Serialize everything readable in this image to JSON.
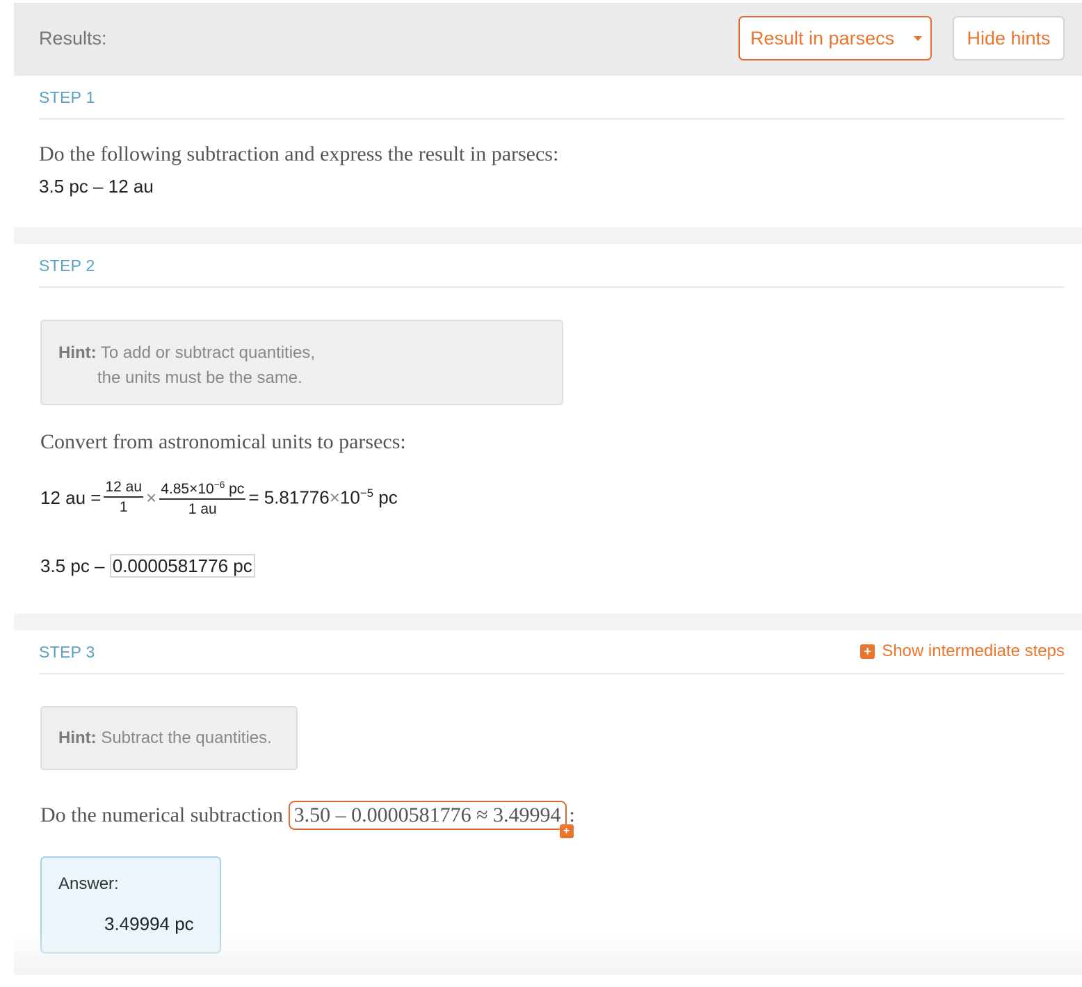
{
  "header": {
    "title": "Results:",
    "unit_select": {
      "selected": "Result in parsecs",
      "icon": "caret-down-icon"
    },
    "hints_button": "Hide hints"
  },
  "colors": {
    "accent": "#e8762f",
    "step_label": "#5c9fc5",
    "answer_bg": "#eaf6fc"
  },
  "steps": [
    {
      "label": "STEP 1",
      "instruction": "Do the following subtraction and express the result in parsecs:",
      "expression": "3.5 pc – 12 au"
    },
    {
      "label": "STEP 2",
      "hint": {
        "prefix": "Hint:",
        "line1": "To add or subtract quantities,",
        "line2": "the units must be the same."
      },
      "instruction": "Convert from astronomical units to parsecs:",
      "conversion": {
        "lhs": "12 au =",
        "frac1_num": "12 au",
        "frac1_den": "1",
        "times": "×",
        "frac2_num_mant": "4.85×10",
        "frac2_num_exp": "−6",
        "frac2_num_unit": " pc",
        "frac2_den": "1 au",
        "result_pre": "= 5.81776",
        "result_times": "×",
        "result_base": "10",
        "result_exp": "−5",
        "result_unit": " pc"
      },
      "restated_left": "3.5 pc –",
      "restated_boxed": "0.0000581776 pc"
    },
    {
      "label": "STEP 3",
      "show_steps": "Show intermediate steps",
      "hint": {
        "prefix": "Hint:",
        "text": "Subtract the quantities."
      },
      "instruction": "Do the numerical subtraction",
      "calculation": "3.50 – 0.0000581776 ≈ 3.49994",
      "colon": ":",
      "answer_label": "Answer:",
      "answer_value": "3.49994 pc"
    }
  ]
}
